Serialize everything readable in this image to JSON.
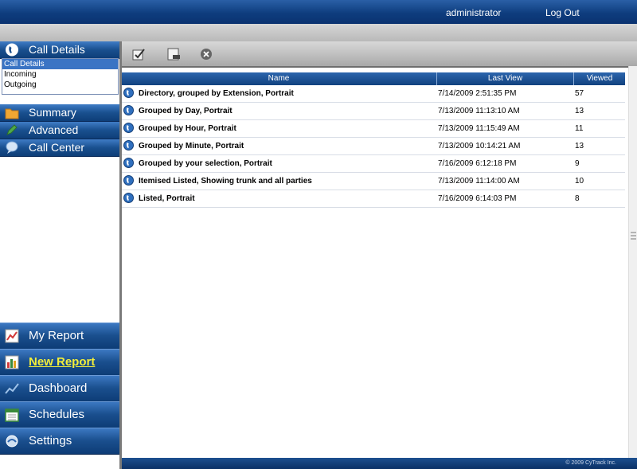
{
  "header": {
    "user": "administrator",
    "logout_label": "Log Out"
  },
  "sidebar": {
    "section_title": "Call Details",
    "sub_items": [
      "Call Details",
      "Incoming",
      "Outgoing"
    ],
    "categories": [
      "Summary",
      "Advanced",
      "Call Center"
    ],
    "bottom_nav": [
      "My Report",
      "New Report",
      "Dashboard",
      "Schedules",
      "Settings"
    ],
    "active_item": "New Report"
  },
  "toolbar": {
    "icons": [
      "checkmark-icon",
      "export-icon",
      "delete-icon"
    ]
  },
  "table": {
    "columns": [
      "Name",
      "Last View",
      "Viewed"
    ],
    "rows": [
      [
        "Directory, grouped by Extension, Portrait",
        "7/14/2009 2:51:35 PM",
        "57"
      ],
      [
        "Grouped by Day, Portrait",
        "7/13/2009 11:13:10 AM",
        "13"
      ],
      [
        "Grouped by Hour, Portrait",
        "7/13/2009 11:15:49 AM",
        "11"
      ],
      [
        "Grouped by Minute, Portrait",
        "7/13/2009 10:14:21 AM",
        "13"
      ],
      [
        "Grouped by your selection, Portrait",
        "7/16/2009 6:12:18 PM",
        "9"
      ],
      [
        "Itemised Listed, Showing trunk and all parties",
        "7/13/2009 11:14:00 AM",
        "10"
      ],
      [
        "Listed, Portrait",
        "7/16/2009 6:14:03 PM",
        "8"
      ]
    ]
  },
  "footer": {
    "copyright": "© 2009 CyTrack Inc."
  },
  "colors": {
    "header_blue": "#0e3d7e",
    "nav_blue": "#1a4f8e",
    "active_label": "#f3ee3a",
    "selected_item": "#3a74c4"
  }
}
